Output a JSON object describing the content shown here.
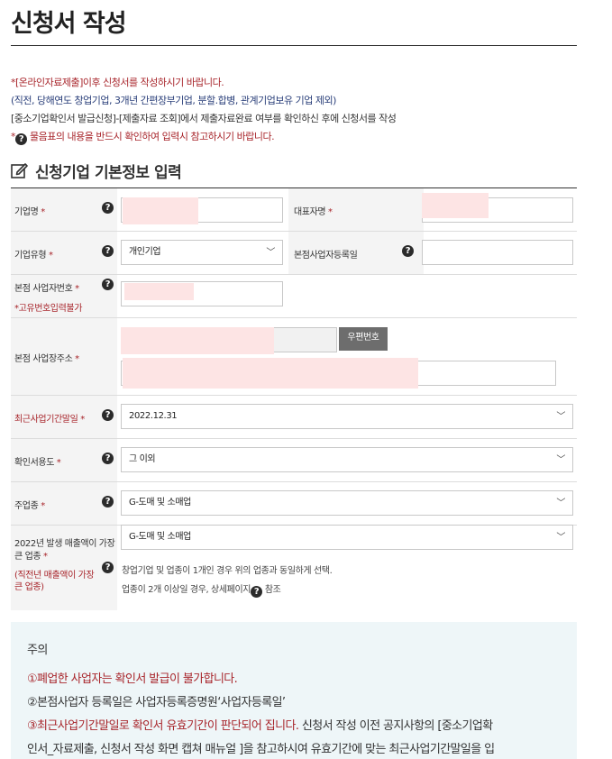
{
  "page_title": "신청서 작성",
  "notices": {
    "line1": "*[온라인자료제출]이후 신청서를 작성하시기 바랍니다.",
    "line2": "(직전, 당해연도 창업기업, 3개년 간편장부기업, 분할.합병, 관계기업보유 기업 제외)",
    "line3": "[중소기업확인서 발급신청]-[제출자료 조회]에서 제출자료완료 여부를 확인하신 후에 신청서를 작성",
    "line4_prefix": "*",
    "line4_text": "물음표의 내용을 반드시 확인하여 입력시 참고하시기 바랍니다."
  },
  "section_title": "신청기업 기본정보 입력",
  "form": {
    "company_name": {
      "label": "기업명",
      "req": "*"
    },
    "ceo_name": {
      "label": "대표자명",
      "req": "*"
    },
    "company_type": {
      "label": "기업유형",
      "req": "*",
      "value": "개인기업"
    },
    "hq_reg_date": {
      "label": "본점사업자등록일"
    },
    "hq_biz_no": {
      "label": "본점 사업자번호",
      "req": "*",
      "note": "*고유번호입력불가"
    },
    "hq_address": {
      "label": "본점 사업장주소",
      "req": "*",
      "zip_button": "우편번호"
    },
    "recent_fiscal_end": {
      "label": "최근사업기간말일",
      "req": "*",
      "value": "2022.12.31"
    },
    "purpose": {
      "label": "확인서용도",
      "req": "*",
      "value": "그 이외"
    },
    "main_industry": {
      "label": "주업종",
      "req": "*",
      "value": "G-도매 및 소매업"
    },
    "largest_sales_industry": {
      "label_line1": "2022년 발생 매출액이 가장",
      "label_line2": "큰 업종",
      "req": "*",
      "sub_line1": "(직전년 매출액이 가장",
      "sub_line2": "큰 업종)",
      "value": "G-도매 및 소매업",
      "hint1": "창업기업 및 업종이 1개인 경우 위의 업종과 동일하게 선택.",
      "hint2_prefix": "업종이 2개 이상일 경우, 상세페이지",
      "hint2_suffix": "참조"
    }
  },
  "caution": {
    "title": "주의",
    "item1": "①폐업한 사업자는 확인서 발급이 불가합니다.",
    "item2": "②본점사업자 등록일은 사업자등록증명원‘사업자등록일’",
    "item3_red": "③최근사업기간말일로 확인서 유효기간이 판단되어 집니다.",
    "item3_black": " 신청서 작성 이전 공지사항의 [중소기업확",
    "item3_line2": "인서_자료제출, 신청서 작성 화면 캡쳐 매뉴얼 ]을 참고하시여 유효기간에 맞는 최근사업기간말일을 입"
  },
  "icons": {
    "help": "question-circle-icon",
    "edit": "edit-icon",
    "chevron": "chevron-down-icon"
  },
  "colors": {
    "required_red": "#a8252b",
    "notice_blue": "#2a3f7a",
    "caution_bg": "#eef6f8"
  }
}
